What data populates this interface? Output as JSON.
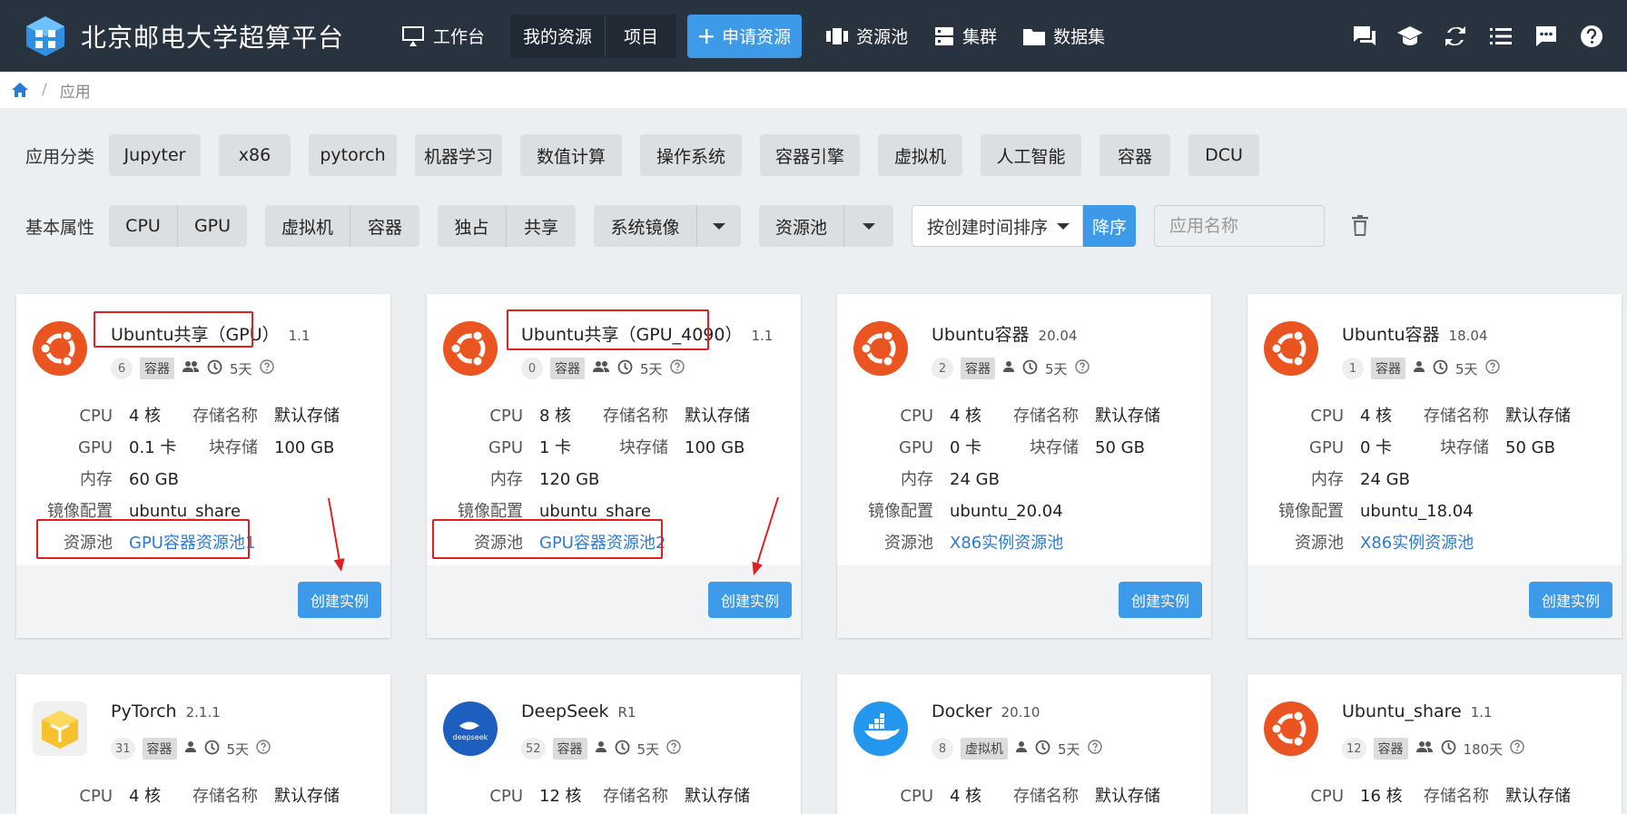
{
  "header": {
    "title": "北京邮电大学超算平台",
    "nav": {
      "workbench": "工作台",
      "my_resources": "我的资源",
      "projects": "项目",
      "apply": "申请资源",
      "pool": "资源池",
      "cluster": "集群",
      "dataset": "数据集"
    }
  },
  "breadcrumb": {
    "home_icon": "home-icon",
    "separator": "/",
    "current": "应用"
  },
  "filters": {
    "category_label": "应用分类",
    "categories": [
      "Jupyter",
      "x86",
      "pytorch",
      "机器学习",
      "数值计算",
      "操作系统",
      "容器引擎",
      "虚拟机",
      "人工智能",
      "容器",
      "DCU"
    ],
    "attr_label": "基本属性",
    "device": [
      "CPU",
      "GPU"
    ],
    "runtime": [
      "虚拟机",
      "容器"
    ],
    "mode": [
      "独占",
      "共享"
    ],
    "image_select": "系统镜像",
    "pool_select": "资源池",
    "sort": "按创建时间排序",
    "sort_dir": "降序",
    "name_placeholder": "应用名称"
  },
  "labels": {
    "cpu": "CPU",
    "gpu": "GPU",
    "mem": "内存",
    "image": "镜像配置",
    "pool": "资源池",
    "storage_name": "存储名称",
    "block": "块存储",
    "create": "创建实例"
  },
  "cards": [
    {
      "name": "Ubuntu共享（GPU）",
      "version": "1.1",
      "count": "6",
      "type": "容器",
      "duration": "5天",
      "cpu": "4 核",
      "gpu": "0.1 卡",
      "mem": "60 GB",
      "image": "ubuntu_share",
      "pool": "GPU容器资源池1",
      "storage": "默认存储",
      "block": "100 GB"
    },
    {
      "name": "Ubuntu共享（GPU_4090）",
      "version": "1.1",
      "count": "0",
      "type": "容器",
      "duration": "5天",
      "cpu": "8 核",
      "gpu": "1 卡",
      "mem": "120 GB",
      "image": "ubuntu_share",
      "pool": "GPU容器资源池2",
      "storage": "默认存储",
      "block": "100 GB"
    },
    {
      "name": "Ubuntu容器",
      "version": "20.04",
      "count": "2",
      "type": "容器",
      "duration": "5天",
      "cpu": "4 核",
      "gpu": "0 卡",
      "mem": "24 GB",
      "image": "ubuntu_20.04",
      "pool": "X86实例资源池",
      "storage": "默认存储",
      "block": "50 GB"
    },
    {
      "name": "Ubuntu容器",
      "version": "18.04",
      "count": "1",
      "type": "容器",
      "duration": "5天",
      "cpu": "4 核",
      "gpu": "0 卡",
      "mem": "24 GB",
      "image": "ubuntu_18.04",
      "pool": "X86实例资源池",
      "storage": "默认存储",
      "block": "50 GB"
    },
    {
      "name": "PyTorch",
      "version": "2.1.1",
      "count": "31",
      "type": "容器",
      "duration": "5天",
      "cpu": "4 核",
      "storage": "默认存储"
    },
    {
      "name": "DeepSeek",
      "version": "R1",
      "count": "52",
      "type": "容器",
      "duration": "5天",
      "cpu": "12 核",
      "storage": "默认存储",
      "logo_text": "deepseek"
    },
    {
      "name": "Docker",
      "version": "20.10",
      "count": "8",
      "type": "虚拟机",
      "duration": "5天",
      "cpu": "4 核",
      "storage": "默认存储"
    },
    {
      "name": "Ubuntu_share",
      "version": "1.1",
      "count": "12",
      "type": "容器",
      "duration": "180天",
      "cpu": "16 核",
      "storage": "默认存储"
    }
  ],
  "colors": {
    "topbar": "#29323f",
    "accent": "#3d9ae8",
    "link": "#2b7bd4",
    "ubuntu": "#e95420",
    "annotation": "#e0201f"
  }
}
